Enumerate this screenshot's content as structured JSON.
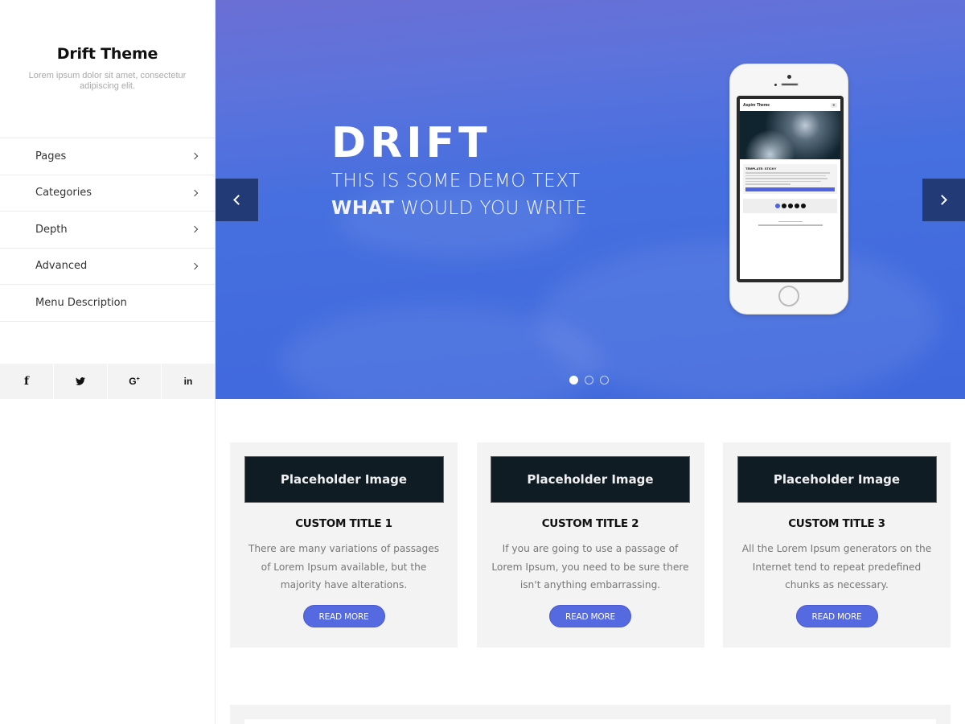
{
  "sidebar": {
    "title": "Drift Theme",
    "tagline": "Lorem ipsum dolor sit amet, consectetur adipiscing elit.",
    "menu": [
      {
        "label": "Pages",
        "has_children": true
      },
      {
        "label": "Categories",
        "has_children": true
      },
      {
        "label": "Depth",
        "has_children": true
      },
      {
        "label": "Advanced",
        "has_children": true
      },
      {
        "label": "Menu Description",
        "has_children": false
      }
    ],
    "social": [
      {
        "icon": "facebook-icon",
        "glyph": "f"
      },
      {
        "icon": "twitter-icon",
        "glyph": "🐦"
      },
      {
        "icon": "google-plus-icon",
        "glyph": "G+"
      },
      {
        "icon": "linkedin-icon",
        "glyph": "in"
      }
    ]
  },
  "hero": {
    "title": "DRIFT",
    "line1": "THIS IS SOME DEMO TEXT",
    "line2_bold": "WHAT",
    "line2_rest": " WOULD YOU WRITE",
    "prev_icon": "chevron-left-icon",
    "next_icon": "chevron-right-icon",
    "slides_count": 3,
    "active_slide": 1,
    "phone": {
      "site_title": "Aspire Theme",
      "post_title": "TEMPLATE: STICKY"
    }
  },
  "cards": [
    {
      "image_label": "Placeholder Image",
      "title": "CUSTOM TITLE 1",
      "text": "There are many variations of passages of Lorem Ipsum available, but the majority have alterations.",
      "button": "READ MORE"
    },
    {
      "image_label": "Placeholder Image",
      "title": "CUSTOM TITLE 2",
      "text": "If you are going to use a passage of Lorem Ipsum, you need to be sure there isn't anything embarrassing.",
      "button": "READ MORE"
    },
    {
      "image_label": "Placeholder Image",
      "title": "CUSTOM TITLE 3",
      "text": "All the Lorem Ipsum generators on the Internet tend to repeat predefined chunks as necessary.",
      "button": "READ MORE"
    }
  ],
  "colors": {
    "accent": "#5569e0",
    "slider_arrow_bg": "#223a75",
    "hero_blue": "#4a6fdf",
    "card_bg": "#f3f3f3",
    "placeholder_bg": "#0f1c24"
  }
}
